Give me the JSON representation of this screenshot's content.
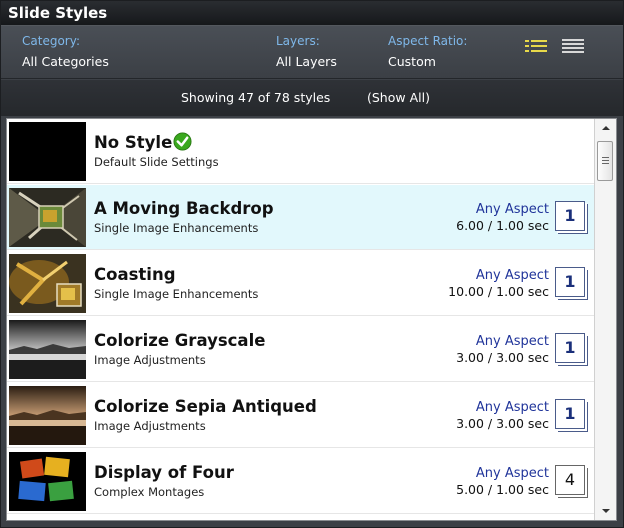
{
  "window": {
    "title": "Slide Styles"
  },
  "filters": {
    "category": {
      "label": "Category:",
      "value": "All Categories"
    },
    "layers": {
      "label": "Layers:",
      "value": "All Layers"
    },
    "aspect_ratio": {
      "label": "Aspect Ratio:",
      "value": "Custom"
    },
    "view_list_icon": "list-view-icon",
    "view_grid_icon": "detail-view-icon"
  },
  "status": {
    "count_text": "Showing 47 of 78 styles",
    "show_all_label": "(Show All)"
  },
  "styles": [
    {
      "title": "No Style",
      "subtitle": "Default Slide Settings",
      "aspect": "",
      "timing": "",
      "layers": "",
      "selected": false,
      "thumb": "black"
    },
    {
      "title": "A Moving Backdrop",
      "subtitle": "Single Image Enhancements",
      "aspect": "Any Aspect",
      "timing": "6.00 / 1.00 sec",
      "layers": "1",
      "selected": true,
      "thumb": "butterfly"
    },
    {
      "title": "Coasting",
      "subtitle": "Single Image Enhancements",
      "aspect": "Any Aspect",
      "timing": "10.00 / 1.00 sec",
      "layers": "1",
      "selected": false,
      "thumb": "butterfly2"
    },
    {
      "title": "Colorize Grayscale",
      "subtitle": "Image Adjustments",
      "aspect": "Any Aspect",
      "timing": "3.00 / 3.00 sec",
      "layers": "1",
      "selected": false,
      "thumb": "gray"
    },
    {
      "title": "Colorize Sepia Antiqued",
      "subtitle": "Image Adjustments",
      "aspect": "Any Aspect",
      "timing": "3.00 / 3.00 sec",
      "layers": "1",
      "selected": false,
      "thumb": "sepia"
    },
    {
      "title": "Display of Four",
      "subtitle": "Complex Montages",
      "aspect": "Any Aspect",
      "timing": "5.00 / 1.00 sec",
      "layers": "4",
      "selected": false,
      "thumb": "four"
    }
  ],
  "colors": {
    "accent_label": "#7fb8ea",
    "selected_row": "#e2f8fc",
    "aspect_text": "#20349a",
    "check_green": "#3aa81e"
  }
}
